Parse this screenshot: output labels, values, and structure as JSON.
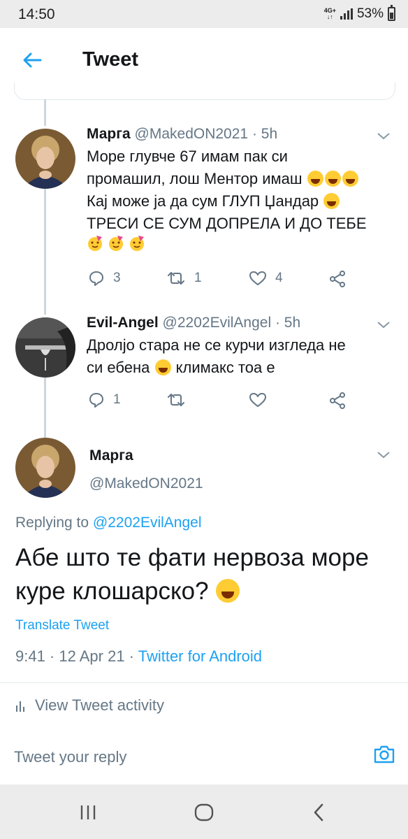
{
  "status_bar": {
    "time": "14:50",
    "network": "4G+",
    "battery": "53%"
  },
  "header": {
    "title": "Tweet"
  },
  "tweets": [
    {
      "name": "Марга",
      "handle": "@MakedON2021",
      "time": "· 5h",
      "lines": [
        "Море глувче 67 имам пак си",
        "промашил, лош Ментор имаш",
        "Кај може ја да сум ГЛУП Џандар",
        "ТРЕСИ СЕ СУМ ДОПРЕЛА И ДО ТЕБЕ"
      ],
      "replies": "3",
      "retweets": "1",
      "likes": "4"
    },
    {
      "name": "Evil-Angel",
      "handle": "@2202EvilAngel",
      "time": "· 5h",
      "lines": [
        "Дролјо стара не се курчи изгледа не",
        "си ебена",
        "климакс тоа е"
      ],
      "replies": "1",
      "retweets": "",
      "likes": ""
    }
  ],
  "focus": {
    "name": "Марга",
    "handle": "@MakedON2021",
    "replying_prefix": "Replying to",
    "replying_to": "@2202EvilAngel",
    "text": "Абе што те фати нервоза море куре клошарско?",
    "translate": "Translate Tweet",
    "timestamp": "9:41 · 12 Apr 21 ·",
    "source": "Twitter for Android"
  },
  "activity": {
    "label": "View Tweet activity"
  },
  "reply_bar": {
    "placeholder": "Tweet your reply"
  },
  "colors": {
    "accent": "#1da1f2",
    "secondary_text": "#657786",
    "divider": "#e1e8ed"
  }
}
